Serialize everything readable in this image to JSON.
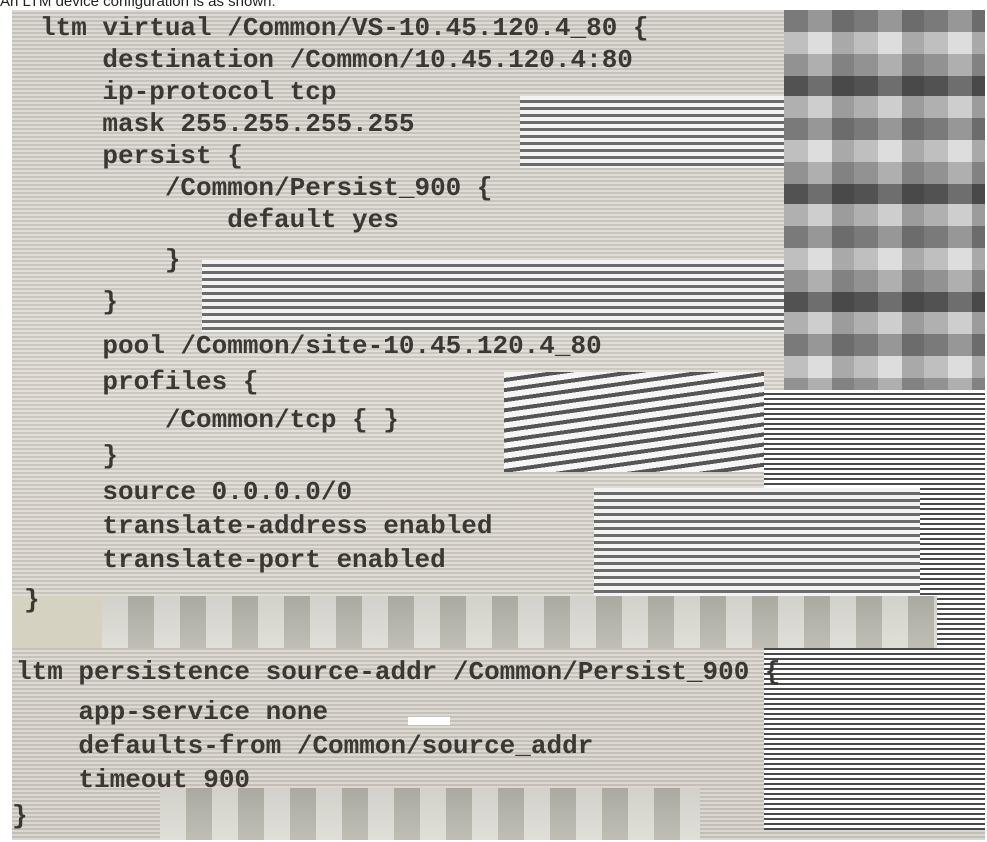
{
  "caption": "An LTM device configuration is as shown:",
  "code_lines": [
    "ltm virtual /Common/VS-10.45.120.4_80 {",
    "    destination /Common/10.45.120.4:80",
    "    ip-protocol tcp",
    "    mask 255.255.255.255",
    "    persist {",
    "        /Common/Persist_900 {",
    "            default yes",
    "        }",
    "    }",
    "    pool /Common/site-10.45.120.4_80",
    "    profiles {",
    "        /Common/tcp { }",
    "    }",
    "    source 0.0.0.0/0",
    "    translate-address enabled",
    "    translate-port enabled",
    "}",
    "",
    "ltm persistence source-addr /Common/Persist_900 {",
    "    app-service none",
    "    defaults-from /Common/source_addr",
    "    timeout 900",
    "}"
  ]
}
